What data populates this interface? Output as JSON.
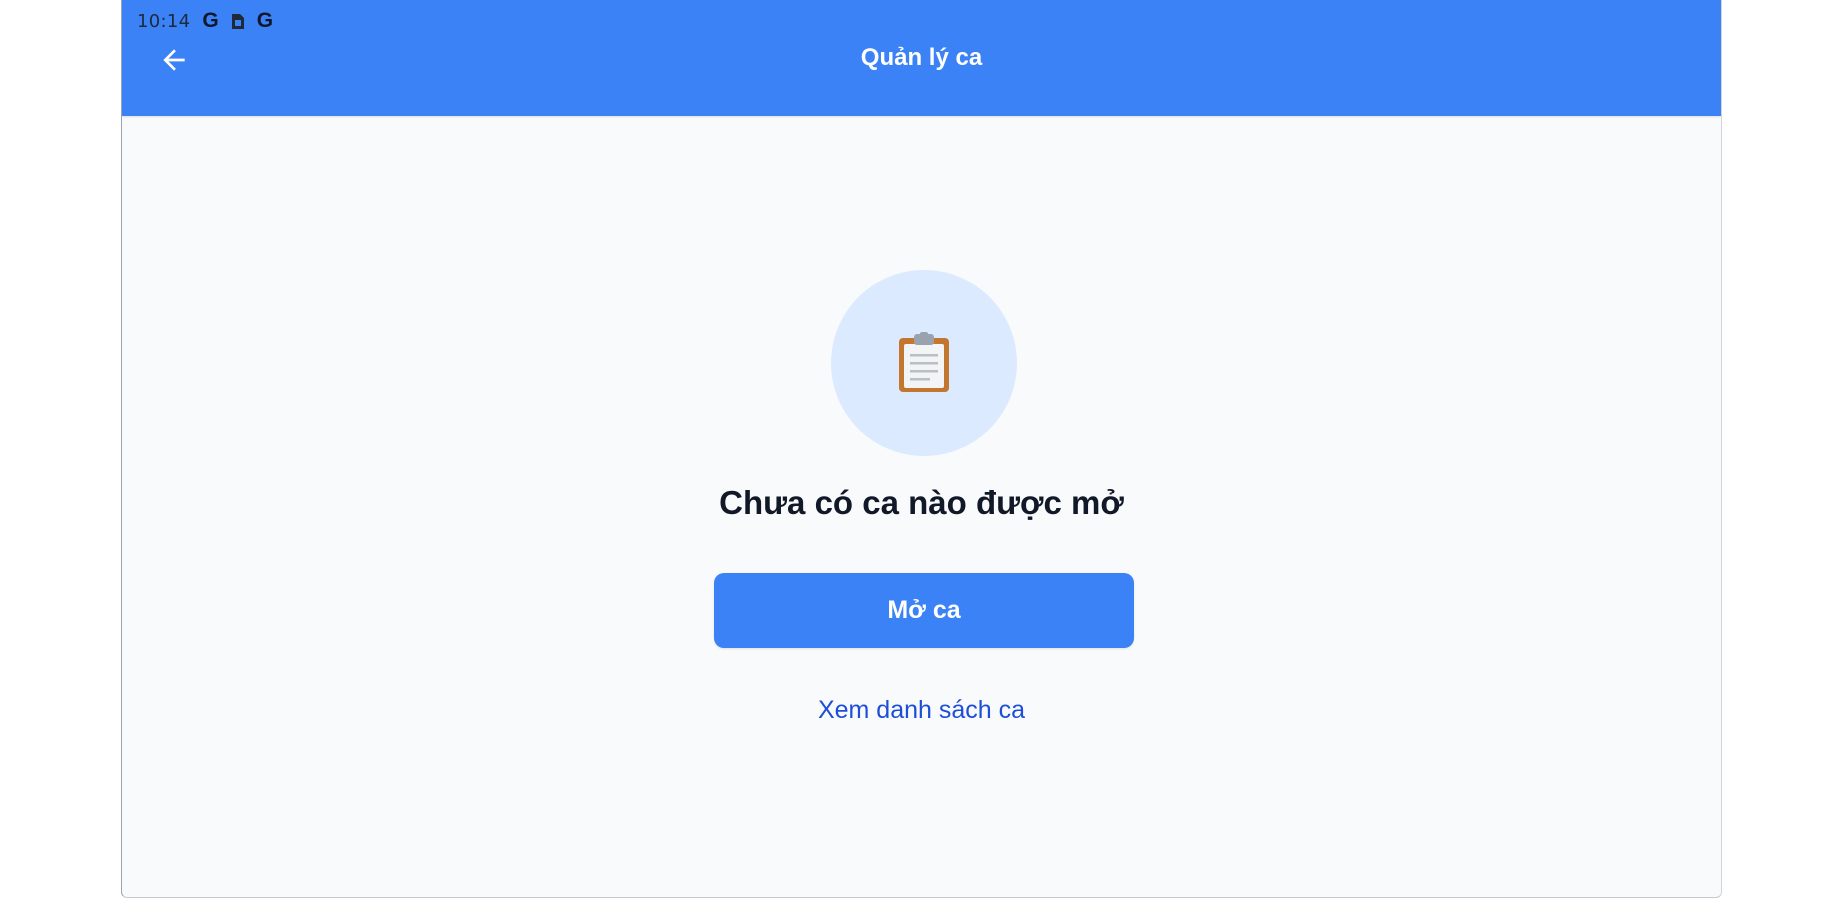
{
  "status_bar": {
    "time": "10:14",
    "icons": [
      "google-g-icon",
      "sim-card-icon",
      "google-g-icon"
    ]
  },
  "app_bar": {
    "title": "Quản lý ca",
    "back_icon": "arrow-left-icon"
  },
  "empty_state": {
    "icon": "clipboard-icon",
    "message": "Chưa có ca nào được mở",
    "primary_button_label": "Mở ca",
    "link_label": "Xem danh sách ca"
  },
  "colors": {
    "primary": "#3b82f6",
    "icon_circle": "#dbeafe",
    "link": "#1d4ed8",
    "background": "#f8fafc"
  }
}
